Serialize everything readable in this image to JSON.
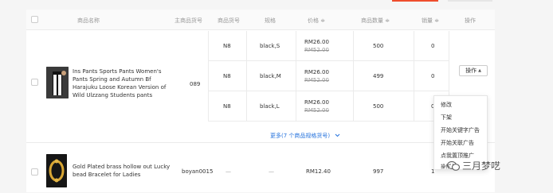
{
  "header": {
    "product_name": "商品名称",
    "main_sku": "主商品货号",
    "sku": "商品货号",
    "spec": "规格",
    "price": "价格 ≑",
    "stock": "商品数量 ≑",
    "sales": "销量 ≑",
    "actions": "操作"
  },
  "products": [
    {
      "name": "Ins Pants Sports Pants Women's Pants Spring and Autumn Bf Harajuku Loose Korean Version of Wild Ulzzang Students pants",
      "main_sku": "089",
      "variants": [
        {
          "sku": "N8",
          "spec": "black,S",
          "price": "RM26.00",
          "orig_price": "RM52.00",
          "stock": "500",
          "sales": "0"
        },
        {
          "sku": "N8",
          "spec": "black,M",
          "price": "RM26.00",
          "orig_price": "RM52.00",
          "stock": "499",
          "sales": "0"
        },
        {
          "sku": "N8",
          "spec": "black,L",
          "price": "RM26.00",
          "orig_price": "RM52.00",
          "stock": "500",
          "sales": "0"
        }
      ],
      "more_label": "更多(7 个商品规格货号)",
      "more_icon": "chevron-down-icon"
    },
    {
      "name": "Gold Plated brass hollow out Lucky bead Bracelet for Ladies",
      "main_sku": "boyan0015",
      "sku": "—",
      "spec": "—",
      "price": "RM12.40",
      "stock": "997",
      "sales": "1"
    }
  ],
  "action_button": {
    "label": "操作",
    "icon": "caret-up-icon"
  },
  "dropdown_menu": [
    "修改",
    "下架",
    "开始关键字广告",
    "开始关联广告",
    "点我置顶推广",
    "操作"
  ],
  "watermark": "三月梦呓",
  "colors": {
    "accent": "#ee4d2d",
    "link": "#2673dd"
  }
}
